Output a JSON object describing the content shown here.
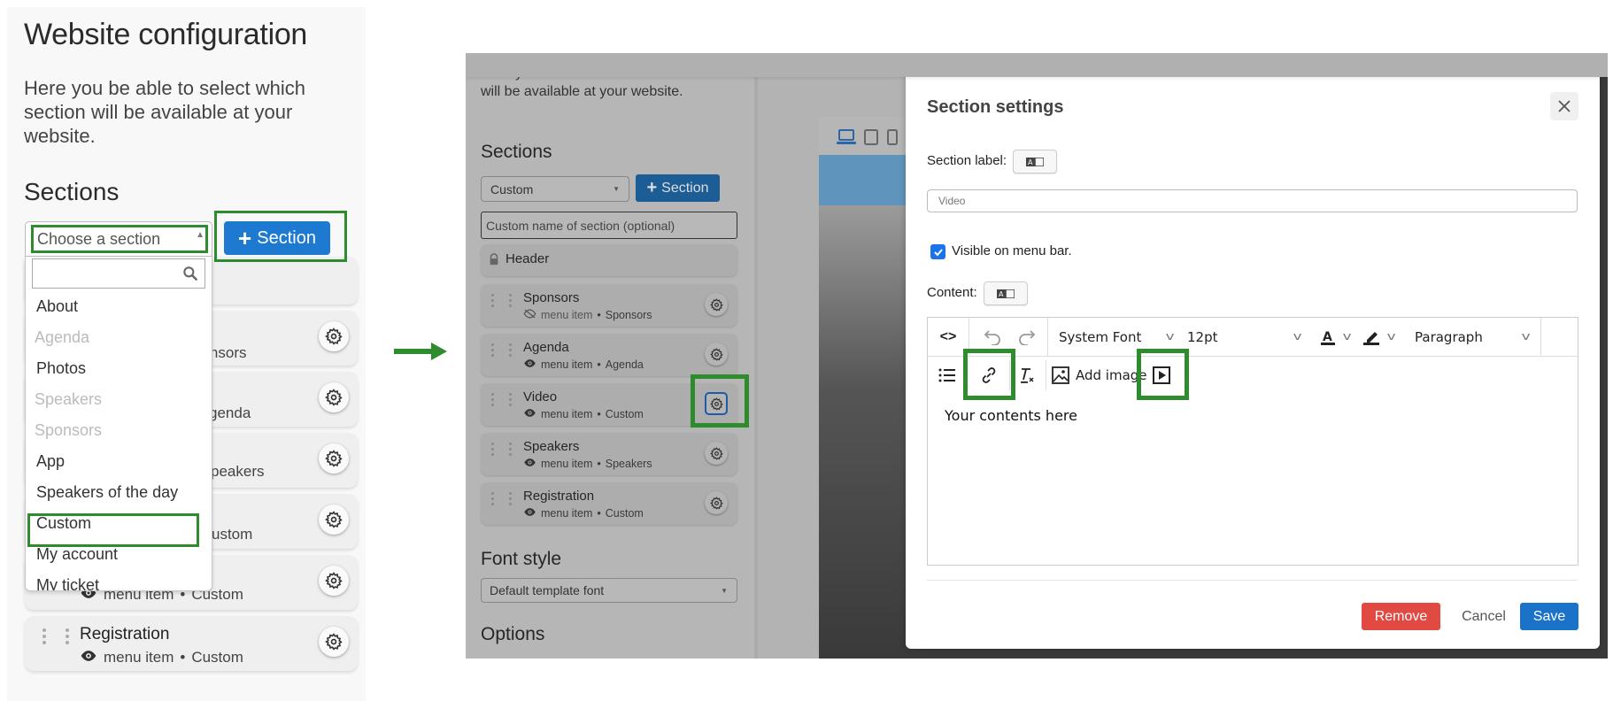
{
  "left_panel": {
    "title": "Website configuration",
    "description": "Here you be able to select which section will be available at your website.",
    "sections_heading": "Sections",
    "select_placeholder": "Choose a section",
    "add_section_button": "Section",
    "dropdown": {
      "search_value": "",
      "items": [
        {
          "label": "About",
          "disabled": false
        },
        {
          "label": "Agenda",
          "disabled": true
        },
        {
          "label": "Photos",
          "disabled": false
        },
        {
          "label": "Speakers",
          "disabled": true
        },
        {
          "label": "Sponsors",
          "disabled": true
        },
        {
          "label": "App",
          "disabled": false
        },
        {
          "label": "Speakers of the day",
          "disabled": false
        },
        {
          "label": "Custom",
          "disabled": false,
          "highlighted": true
        },
        {
          "label": "My account",
          "disabled": false
        },
        {
          "label": "My ticket",
          "disabled": false
        }
      ]
    },
    "cards": [
      {
        "name": "",
        "sub_partial": "ponsors"
      },
      {
        "name": "",
        "sub_partial": "genda"
      },
      {
        "name": "",
        "sub_partial": "peakers"
      },
      {
        "name": "",
        "sub_partial": "ustom"
      },
      {
        "name": "",
        "menu_item": "menu item",
        "type": "Custom"
      },
      {
        "name": "Registration",
        "menu_item": "menu item",
        "type": "Custom"
      }
    ]
  },
  "right_panel": {
    "description": "Here you be able to select which section will be available at your website.",
    "sections_heading": "Sections",
    "section_select_value": "Custom",
    "add_section_button": "Section",
    "custom_name_placeholder": "Custom name of section (optional)",
    "header_item": "Header",
    "cards": [
      {
        "name": "Sponsors",
        "menu_item": "menu item",
        "type": "Sponsors",
        "visible": false
      },
      {
        "name": "Agenda",
        "menu_item": "menu item",
        "type": "Agenda",
        "visible": true
      },
      {
        "name": "Video",
        "menu_item": "menu item",
        "type": "Custom",
        "visible": true,
        "highlighted": true
      },
      {
        "name": "Speakers",
        "menu_item": "menu item",
        "type": "Speakers",
        "visible": true
      },
      {
        "name": "Registration",
        "menu_item": "menu item",
        "type": "Custom",
        "visible": true
      }
    ],
    "font_style_heading": "Font style",
    "font_style_value": "Default template font",
    "options_heading": "Options"
  },
  "modal": {
    "title": "Section settings",
    "section_label": "Section label:",
    "section_label_value": "Video",
    "visible_on_menu_bar": "Visible on menu bar.",
    "visible_checked": true,
    "content_label": "Content:",
    "editor": {
      "font_family": "System Font",
      "font_size": "12pt",
      "block_format": "Paragraph",
      "add_image": "Add image",
      "content": "Your contents here"
    },
    "buttons": {
      "remove": "Remove",
      "cancel": "Cancel",
      "save": "Save"
    }
  },
  "colors": {
    "highlight": "#2e8b2e",
    "primary": "#1e7ad1",
    "danger": "#e04a43"
  }
}
